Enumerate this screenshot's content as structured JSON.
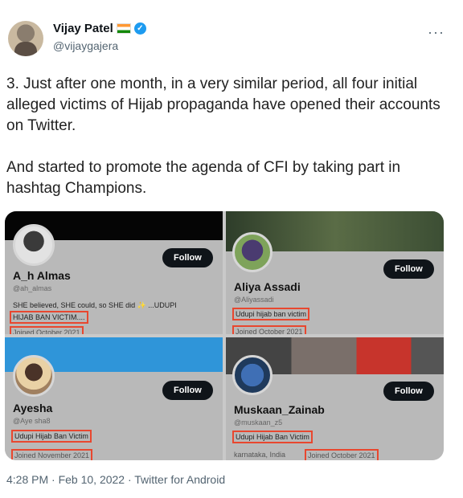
{
  "tweet": {
    "author_name": "Vijay Patel",
    "author_handle": "@vijaygajera",
    "more_icon": "···",
    "paragraphs": [
      "3. Just after one month, in a very similar period, all four initial alleged victims of Hijab propaganda have opened their accounts on Twitter.",
      "And started to promote the agenda of CFI by taking part in hashtag Champions."
    ],
    "timestamp": "4:28 PM · Feb 10, 2022 · Twitter for Android"
  },
  "profiles": [
    {
      "name": "A_h Almas",
      "handle": "@ah_almas",
      "bio": "SHE believed, SHE could, so SHE did ✨ ...UDUPI",
      "bio2": "HIJAB BAN VICTIM....",
      "meta": "Joined October 2021",
      "follow_label": "Follow"
    },
    {
      "name": "Aliya Assadi",
      "handle": "@Aliyassadi",
      "bio": "Udupi hijab ban victim",
      "meta": "Joined October 2021",
      "follow_label": "Follow"
    },
    {
      "name": "Ayesha",
      "handle": "@Aye sha8",
      "bio": "Udupi Hijab Ban Victim",
      "meta": "Joined November 2021",
      "follow_label": "Follow"
    },
    {
      "name": "Muskaan_Zainab",
      "handle": "@muskaan_z5",
      "bio": "Udupi Hijab Ban Victim",
      "location": "karnataka, India",
      "meta": "Joined October 2021",
      "follow_label": "Follow"
    }
  ],
  "colors": {
    "accent": "#1d9bf0",
    "highlight": "#e8472f"
  }
}
